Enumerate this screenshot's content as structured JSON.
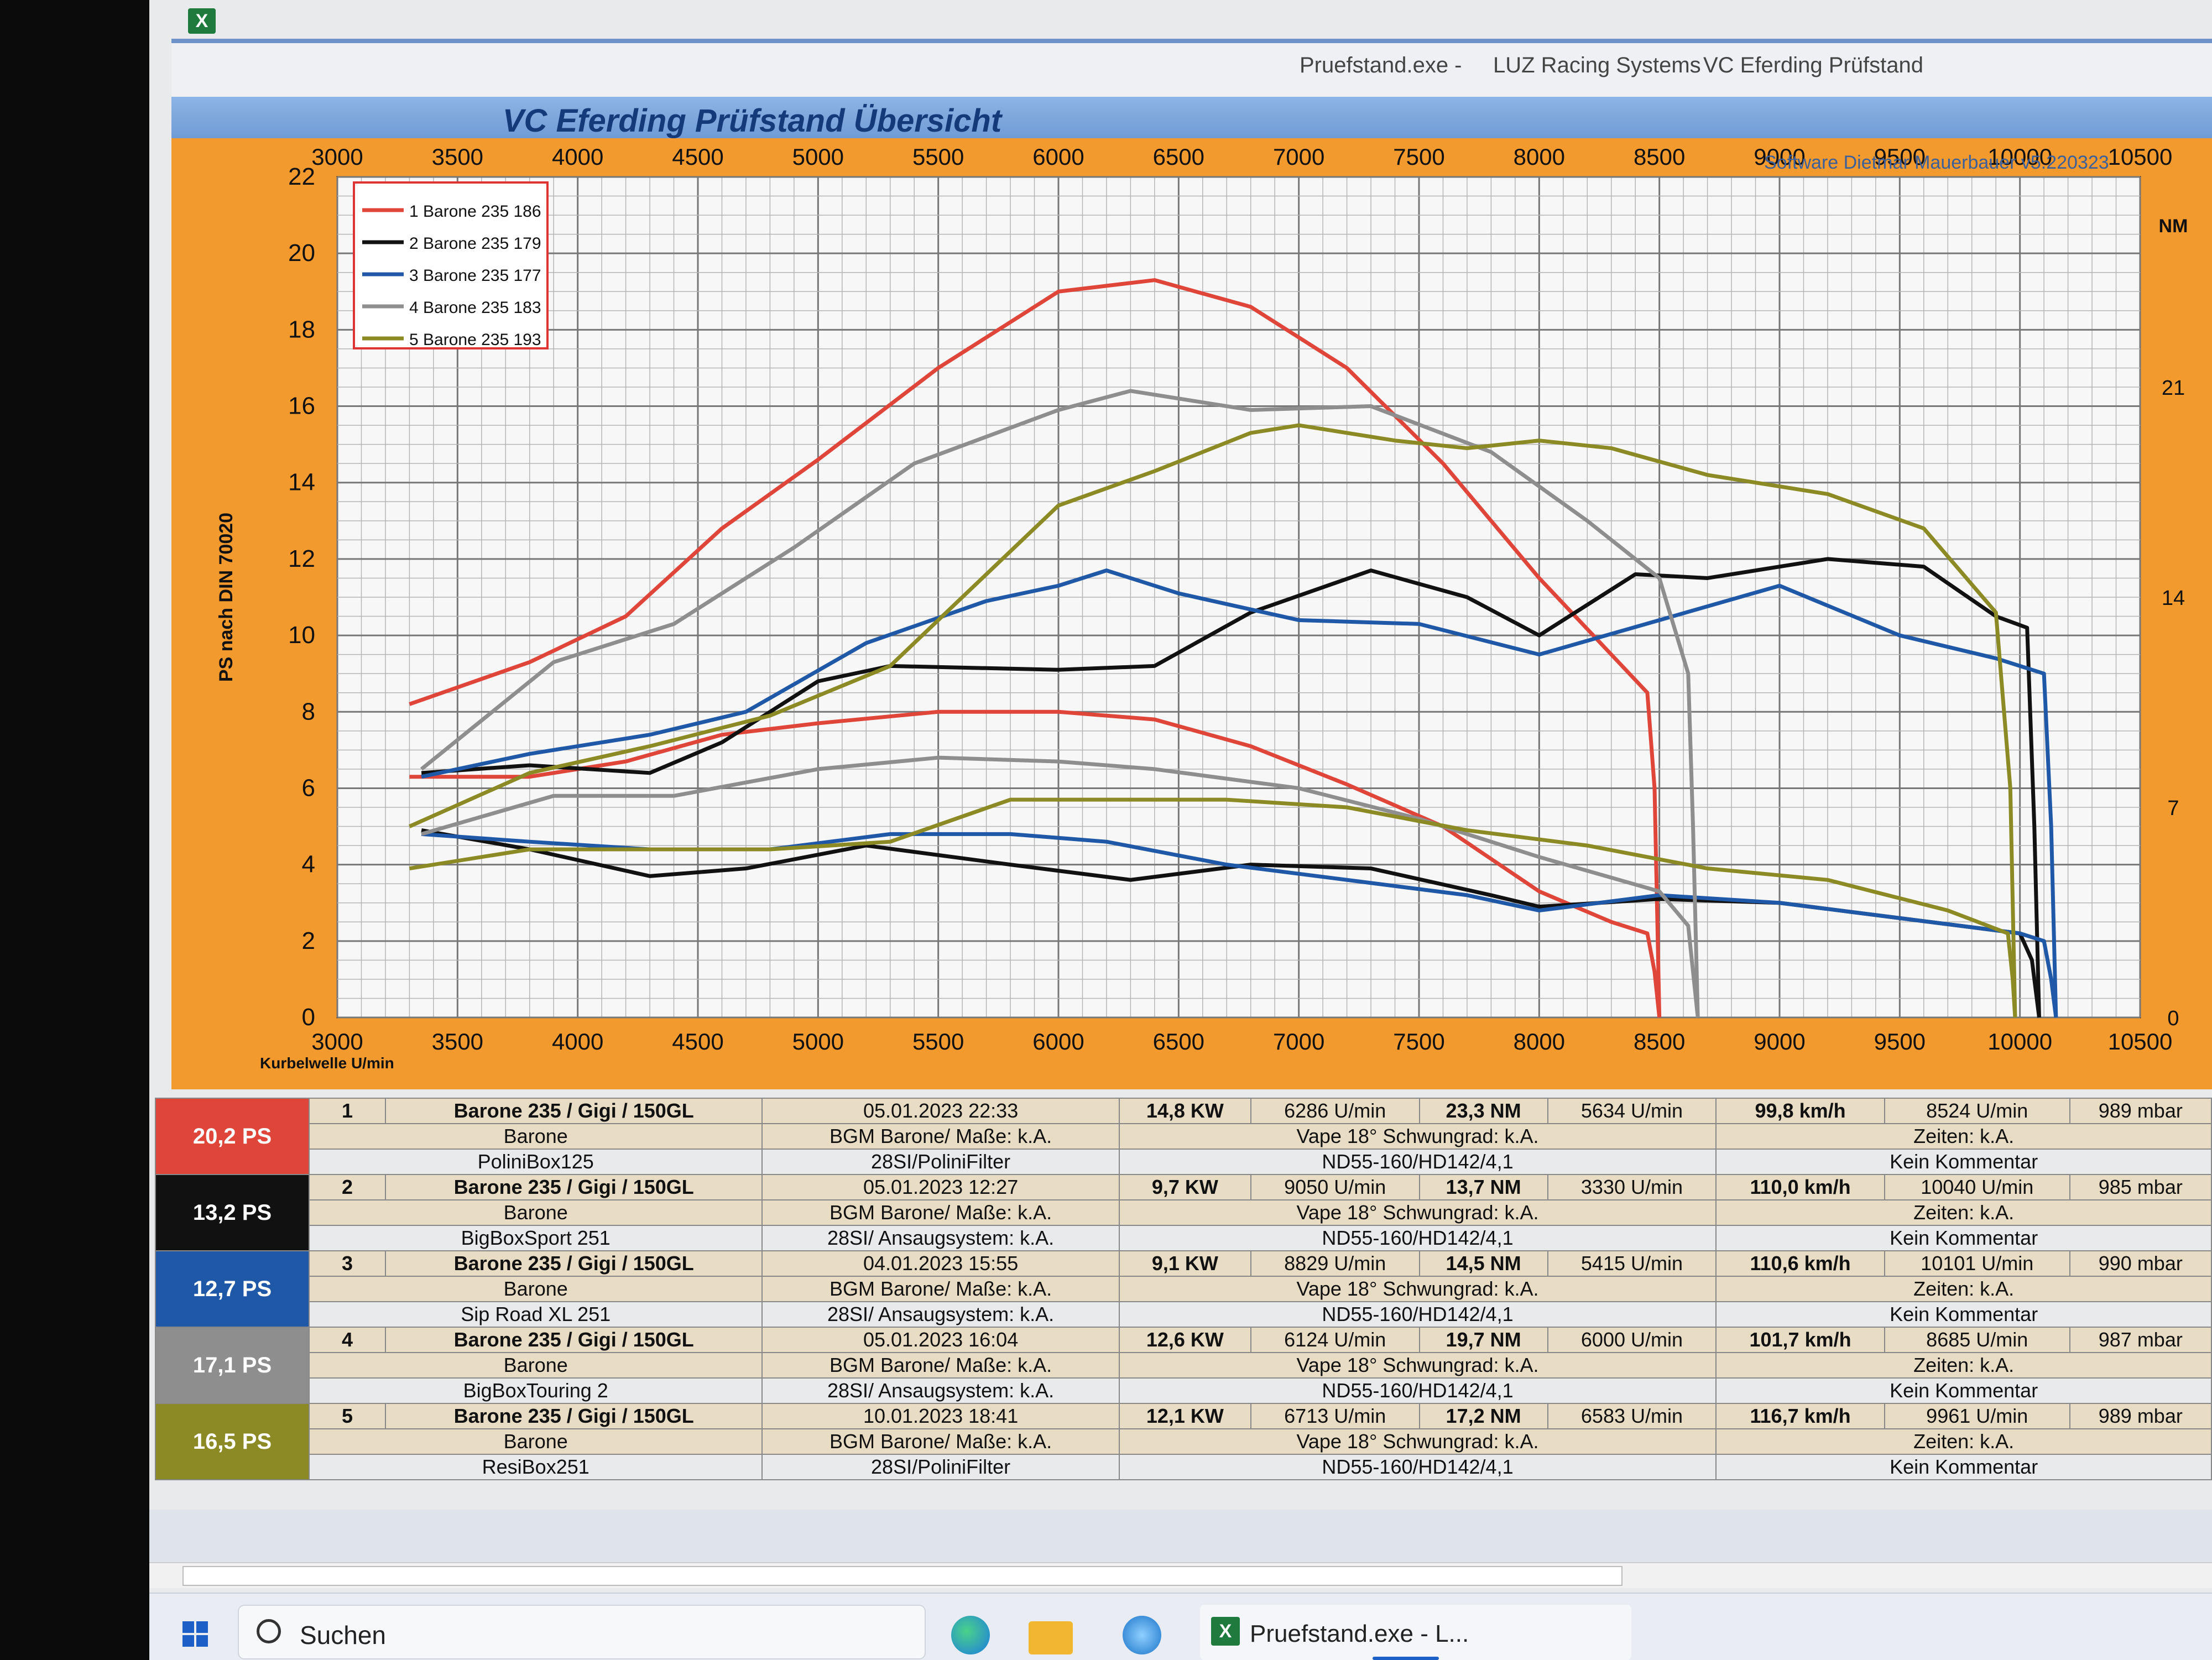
{
  "window": {
    "app_title": "Pruefstand.exe -",
    "company": "LUZ Racing Systems",
    "app_name": "VC Eferding Prüfstand"
  },
  "chart_header": {
    "title": "VC Eferding Prüfstand  Übersicht",
    "software": "Software Dietmar Mauerbauer v5.220323"
  },
  "colors": {
    "red": "#e0453a",
    "black": "#111111",
    "blue": "#2058a8",
    "gray": "#8e8e8e",
    "olive": "#8c8a24",
    "frame": "#f29a2e"
  },
  "chart_data": {
    "type": "line",
    "xlabel": "Kurbelwelle U/min",
    "ylabel": "PS nach DIN 70020",
    "y2label": "NM",
    "xlim": [
      3000,
      10500
    ],
    "ylim": [
      0,
      22
    ],
    "y2lim": [
      0,
      28
    ],
    "x_ticks": [
      3000,
      3500,
      4000,
      4500,
      5000,
      5500,
      6000,
      6500,
      7000,
      7500,
      8000,
      8500,
      9000,
      9500,
      10000,
      10500
    ],
    "y_ticks": [
      0,
      2,
      4,
      6,
      8,
      10,
      12,
      14,
      16,
      18,
      20,
      22
    ],
    "y2_ticks": [
      0,
      7,
      14,
      21
    ],
    "grid": true,
    "legend_position": "top-left",
    "series": [
      {
        "name": "Barone 235 186",
        "color": "#e0453a",
        "power": [
          [
            3300,
            8.2
          ],
          [
            3800,
            9.3
          ],
          [
            4200,
            10.5
          ],
          [
            4600,
            12.8
          ],
          [
            5000,
            14.6
          ],
          [
            5500,
            17.0
          ],
          [
            6000,
            19.0
          ],
          [
            6400,
            19.3
          ],
          [
            6800,
            18.6
          ],
          [
            7200,
            17.0
          ],
          [
            7600,
            14.5
          ],
          [
            8000,
            11.5
          ],
          [
            8300,
            9.5
          ],
          [
            8450,
            8.5
          ],
          [
            8480,
            6.0
          ],
          [
            8500,
            0
          ]
        ],
        "torque": [
          [
            3300,
            6.3
          ],
          [
            3800,
            6.3
          ],
          [
            4200,
            6.7
          ],
          [
            4600,
            7.4
          ],
          [
            5000,
            7.7
          ],
          [
            5500,
            8.0
          ],
          [
            6000,
            8.0
          ],
          [
            6400,
            7.8
          ],
          [
            6800,
            7.1
          ],
          [
            7200,
            6.1
          ],
          [
            7600,
            5.0
          ],
          [
            8000,
            3.3
          ],
          [
            8300,
            2.5
          ],
          [
            8450,
            2.2
          ],
          [
            8480,
            1.2
          ],
          [
            8500,
            0
          ]
        ]
      },
      {
        "name": "Barone 235 179",
        "color": "#111111",
        "power": [
          [
            3350,
            6.4
          ],
          [
            3800,
            6.6
          ],
          [
            4300,
            6.4
          ],
          [
            4600,
            7.2
          ],
          [
            5000,
            8.8
          ],
          [
            5300,
            9.2
          ],
          [
            6000,
            9.1
          ],
          [
            6400,
            9.2
          ],
          [
            6800,
            10.6
          ],
          [
            7300,
            11.7
          ],
          [
            7700,
            11.0
          ],
          [
            8000,
            10.0
          ],
          [
            8400,
            11.6
          ],
          [
            8700,
            11.5
          ],
          [
            9200,
            12.0
          ],
          [
            9600,
            11.8
          ],
          [
            9900,
            10.5
          ],
          [
            10030,
            10.2
          ],
          [
            10060,
            5.0
          ],
          [
            10080,
            0
          ]
        ],
        "torque": [
          [
            3350,
            4.9
          ],
          [
            3800,
            4.4
          ],
          [
            4300,
            3.7
          ],
          [
            4700,
            3.9
          ],
          [
            5200,
            4.5
          ],
          [
            5800,
            4.0
          ],
          [
            6300,
            3.6
          ],
          [
            6800,
            4.0
          ],
          [
            7300,
            3.9
          ],
          [
            7800,
            3.2
          ],
          [
            8000,
            2.9
          ],
          [
            8500,
            3.1
          ],
          [
            9000,
            3.0
          ],
          [
            9500,
            2.6
          ],
          [
            10000,
            2.2
          ],
          [
            10050,
            1.5
          ],
          [
            10080,
            0
          ]
        ]
      },
      {
        "name": "Barone 235 177",
        "color": "#2058a8",
        "power": [
          [
            3350,
            6.3
          ],
          [
            3800,
            6.9
          ],
          [
            4300,
            7.4
          ],
          [
            4700,
            8.0
          ],
          [
            5200,
            9.8
          ],
          [
            5700,
            10.9
          ],
          [
            6000,
            11.3
          ],
          [
            6200,
            11.7
          ],
          [
            6500,
            11.1
          ],
          [
            7000,
            10.4
          ],
          [
            7500,
            10.3
          ],
          [
            8000,
            9.5
          ],
          [
            8500,
            10.4
          ],
          [
            9000,
            11.3
          ],
          [
            9500,
            10.0
          ],
          [
            9900,
            9.4
          ],
          [
            10100,
            9.0
          ],
          [
            10130,
            5.0
          ],
          [
            10150,
            0
          ]
        ],
        "torque": [
          [
            3350,
            4.8
          ],
          [
            3800,
            4.6
          ],
          [
            4300,
            4.4
          ],
          [
            4800,
            4.4
          ],
          [
            5300,
            4.8
          ],
          [
            5800,
            4.8
          ],
          [
            6200,
            4.6
          ],
          [
            6700,
            4.0
          ],
          [
            7200,
            3.6
          ],
          [
            7700,
            3.2
          ],
          [
            8000,
            2.8
          ],
          [
            8500,
            3.2
          ],
          [
            9000,
            3.0
          ],
          [
            9500,
            2.6
          ],
          [
            10000,
            2.2
          ],
          [
            10100,
            2.0
          ],
          [
            10130,
            1.0
          ],
          [
            10150,
            0
          ]
        ]
      },
      {
        "name": "Barone 235 183",
        "color": "#8e8e8e",
        "power": [
          [
            3350,
            6.5
          ],
          [
            3900,
            9.3
          ],
          [
            4400,
            10.3
          ],
          [
            4900,
            12.3
          ],
          [
            5400,
            14.5
          ],
          [
            6000,
            15.9
          ],
          [
            6300,
            16.4
          ],
          [
            6800,
            15.9
          ],
          [
            7300,
            16.0
          ],
          [
            7800,
            14.8
          ],
          [
            8200,
            13.0
          ],
          [
            8500,
            11.5
          ],
          [
            8620,
            9.0
          ],
          [
            8640,
            5.0
          ],
          [
            8660,
            0
          ]
        ],
        "torque": [
          [
            3350,
            4.8
          ],
          [
            3900,
            5.8
          ],
          [
            4400,
            5.8
          ],
          [
            5000,
            6.5
          ],
          [
            5500,
            6.8
          ],
          [
            6000,
            6.7
          ],
          [
            6400,
            6.5
          ],
          [
            7000,
            6.0
          ],
          [
            7500,
            5.2
          ],
          [
            8000,
            4.2
          ],
          [
            8500,
            3.3
          ],
          [
            8620,
            2.4
          ],
          [
            8640,
            1.2
          ],
          [
            8660,
            0
          ]
        ]
      },
      {
        "name": "Barone 235 193",
        "color": "#8c8a24",
        "power": [
          [
            3300,
            5.0
          ],
          [
            3800,
            6.4
          ],
          [
            4300,
            7.1
          ],
          [
            4800,
            7.9
          ],
          [
            5300,
            9.2
          ],
          [
            5700,
            11.6
          ],
          [
            6000,
            13.4
          ],
          [
            6400,
            14.3
          ],
          [
            6800,
            15.3
          ],
          [
            7000,
            15.5
          ],
          [
            7400,
            15.1
          ],
          [
            7700,
            14.9
          ],
          [
            8000,
            15.1
          ],
          [
            8300,
            14.9
          ],
          [
            8700,
            14.2
          ],
          [
            9200,
            13.7
          ],
          [
            9600,
            12.8
          ],
          [
            9900,
            10.6
          ],
          [
            9960,
            6.0
          ],
          [
            9980,
            0
          ]
        ],
        "torque": [
          [
            3300,
            3.9
          ],
          [
            3800,
            4.4
          ],
          [
            4300,
            4.4
          ],
          [
            4800,
            4.4
          ],
          [
            5300,
            4.6
          ],
          [
            5800,
            5.7
          ],
          [
            6200,
            5.7
          ],
          [
            6700,
            5.7
          ],
          [
            7200,
            5.5
          ],
          [
            7700,
            4.9
          ],
          [
            8200,
            4.5
          ],
          [
            8700,
            3.9
          ],
          [
            9200,
            3.6
          ],
          [
            9700,
            2.8
          ],
          [
            9950,
            2.2
          ],
          [
            9970,
            1.0
          ],
          [
            9980,
            0
          ]
        ]
      }
    ]
  },
  "results": [
    {
      "ps": "20,2  PS",
      "num": "1",
      "title": "Barone 235 / Gigi / 150GL",
      "date": "05.01.2023 22:33",
      "kw": "14,8  KW",
      "rpm1": "6286  U/min",
      "nm": "23,3  NM",
      "rpm2": "5634  U/min",
      "speed": "99,8 km/h",
      "rpm3": "8524  U/min",
      "mbar": "989  mbar",
      "vehicle": "Barone",
      "measure": "BGM Barone/ Maße: k.A.",
      "engine": "Vape 18° Schwungrad: k.A.",
      "times": "Zeiten: k.A.",
      "exhaust": "PoliniBox125",
      "intake": "28SI/PoliniFilter",
      "carb": "ND55-160/HD142/4,1",
      "comment": "Kein Kommentar",
      "color": "#e0453a"
    },
    {
      "ps": "13,2  PS",
      "num": "2",
      "title": "Barone 235 / Gigi / 150GL",
      "date": "05.01.2023 12:27",
      "kw": "9,7  KW",
      "rpm1": "9050  U/min",
      "nm": "13,7  NM",
      "rpm2": "3330  U/min",
      "speed": "110,0 km/h",
      "rpm3": "10040  U/min",
      "mbar": "985  mbar",
      "vehicle": "Barone",
      "measure": "BGM Barone/ Maße: k.A.",
      "engine": "Vape 18° Schwungrad: k.A.",
      "times": "Zeiten: k.A.",
      "exhaust": "BigBoxSport 251",
      "intake": "28SI/ Ansaugsystem: k.A.",
      "carb": "ND55-160/HD142/4,1",
      "comment": "Kein Kommentar",
      "color": "#111111"
    },
    {
      "ps": "12,7  PS",
      "num": "3",
      "title": "Barone 235 / Gigi / 150GL",
      "date": "04.01.2023 15:55",
      "kw": "9,1  KW",
      "rpm1": "8829  U/min",
      "nm": "14,5  NM",
      "rpm2": "5415  U/min",
      "speed": "110,6 km/h",
      "rpm3": "10101  U/min",
      "mbar": "990  mbar",
      "vehicle": "Barone",
      "measure": "BGM Barone/ Maße: k.A.",
      "engine": "Vape 18° Schwungrad: k.A.",
      "times": "Zeiten: k.A.",
      "exhaust": "Sip Road XL 251",
      "intake": "28SI/ Ansaugsystem: k.A.",
      "carb": "ND55-160/HD142/4,1",
      "comment": "Kein Kommentar",
      "color": "#2058a8"
    },
    {
      "ps": "17,1  PS",
      "num": "4",
      "title": "Barone 235 / Gigi / 150GL",
      "date": "05.01.2023 16:04",
      "kw": "12,6  KW",
      "rpm1": "6124  U/min",
      "nm": "19,7  NM",
      "rpm2": "6000  U/min",
      "speed": "101,7 km/h",
      "rpm3": "8685  U/min",
      "mbar": "987  mbar",
      "vehicle": "Barone",
      "measure": "BGM Barone/ Maße: k.A.",
      "engine": "Vape 18° Schwungrad: k.A.",
      "times": "Zeiten: k.A.",
      "exhaust": "BigBoxTouring 2",
      "intake": "28SI/ Ansaugsystem: k.A.",
      "carb": "ND55-160/HD142/4,1",
      "comment": "Kein Kommentar",
      "color": "#8e8e8e"
    },
    {
      "ps": "16,5  PS",
      "num": "5",
      "title": "Barone 235 / Gigi / 150GL",
      "date": "10.01.2023 18:41",
      "kw": "12,1  KW",
      "rpm1": "6713  U/min",
      "nm": "17,2  NM",
      "rpm2": "6583  U/min",
      "speed": "116,7 km/h",
      "rpm3": "9961  U/min",
      "mbar": "989  mbar",
      "vehicle": "Barone",
      "measure": "BGM Barone/ Maße: k.A.",
      "engine": "Vape 18° Schwungrad: k.A.",
      "times": "Zeiten: k.A.",
      "exhaust": "ResiBox251",
      "intake": "28SI/PoliniFilter",
      "carb": "ND55-160/HD142/4,1",
      "comment": "Kein Kommentar",
      "color": "#8c8a24"
    }
  ],
  "taskbar": {
    "search_label": "Suchen",
    "excel_task_label": "Pruefstand.exe -  L...",
    "excel_glyph": "X"
  }
}
